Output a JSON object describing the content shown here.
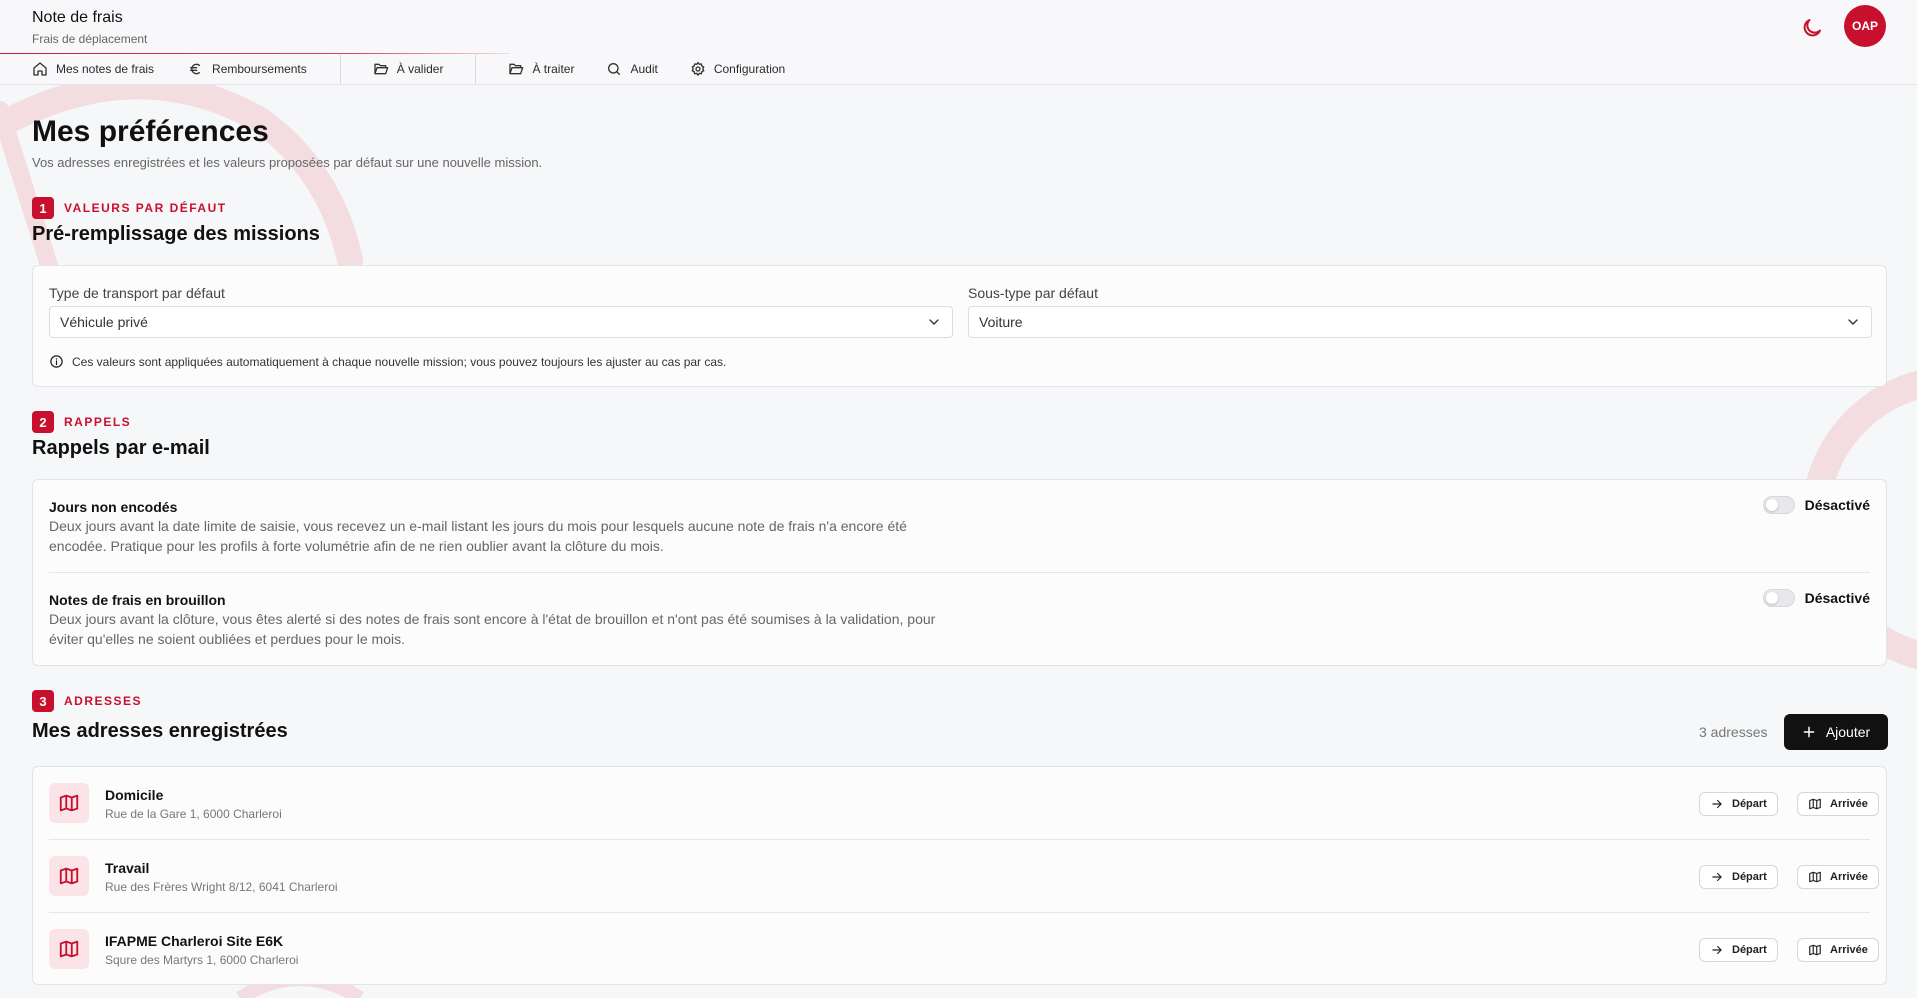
{
  "header": {
    "app_title": "Note de frais",
    "app_subtitle": "Frais de déplacement",
    "avatar_initials": "OAP",
    "accent_color": "#c8102e"
  },
  "nav": {
    "items": [
      {
        "label": "Mes notes de frais",
        "icon": "home-icon"
      },
      {
        "label": "Remboursements",
        "icon": "euro-icon"
      },
      {
        "label": "À valider",
        "icon": "folder-open-icon"
      },
      {
        "label": "À traiter",
        "icon": "folder-open-icon"
      },
      {
        "label": "Audit",
        "icon": "search-icon"
      },
      {
        "label": "Configuration",
        "icon": "gear-icon"
      }
    ]
  },
  "page": {
    "title": "Mes préférences",
    "subtitle": "Vos adresses enregistrées et les valeurs proposées par défaut sur une nouvelle mission."
  },
  "section_defaults": {
    "number": "1",
    "label": "VALEURS PAR DÉFAUT",
    "title": "Pré-remplissage des missions",
    "transport_label": "Type de transport par défaut",
    "transport_value": "Véhicule privé",
    "subtype_label": "Sous-type par défaut",
    "subtype_value": "Voiture",
    "info_text": "Ces valeurs sont appliquées automatiquement à chaque nouvelle mission; vous pouvez toujours les ajuster au cas par cas."
  },
  "section_reminders": {
    "number": "2",
    "label": "RAPPELS",
    "title": "Rappels par e-mail",
    "items": [
      {
        "title": "Jours non encodés",
        "description": "Deux jours avant la date limite de saisie, vous recevez un e-mail listant les jours du mois pour lesquels aucune note de frais n'a encore été encodée. Pratique pour les profils à forte volumétrie afin de ne rien oublier avant la clôture du mois.",
        "status": "Désactivé"
      },
      {
        "title": "Notes de frais en brouillon",
        "description": "Deux jours avant la clôture, vous êtes alerté si des notes de frais sont encore à l'état de brouillon et n'ont pas été soumises à la validation, pour éviter qu'elles ne soient oubliées et perdues pour le mois.",
        "status": "Désactivé"
      }
    ]
  },
  "section_addresses": {
    "number": "3",
    "label": "ADRESSES",
    "title": "Mes adresses enregistrées",
    "count_text": "3 adresses",
    "add_label": "Ajouter",
    "depart_label": "Départ",
    "arrivee_label": "Arrivée",
    "items": [
      {
        "name": "Domicile",
        "address": "Rue de la Gare 1, 6000 Charleroi"
      },
      {
        "name": "Travail",
        "address": "Rue des Frères Wright 8/12, 6041 Charleroi"
      },
      {
        "name": "IFAPME Charleroi Site E6K",
        "address": "Squre des Martyrs 1, 6000 Charleroi"
      }
    ]
  }
}
